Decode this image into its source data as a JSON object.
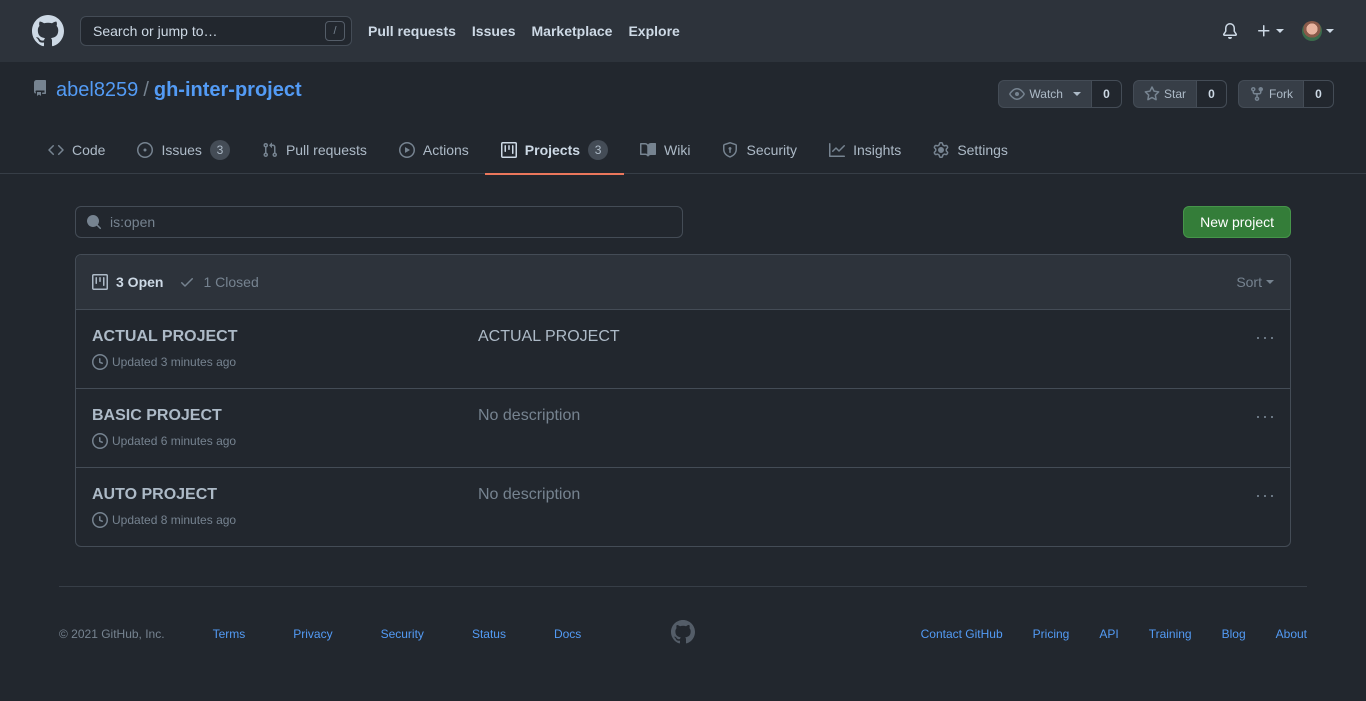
{
  "header": {
    "search_placeholder": "Search or jump to…",
    "search_shortcut": "/",
    "nav": [
      "Pull requests",
      "Issues",
      "Marketplace",
      "Explore"
    ]
  },
  "repo": {
    "owner": "abel8259",
    "separator": "/",
    "name": "gh-inter-project",
    "watch_label": "Watch",
    "watch_count": "0",
    "star_label": "Star",
    "star_count": "0",
    "fork_label": "Fork",
    "fork_count": "0"
  },
  "tabs": [
    {
      "label": "Code",
      "icon": "code-icon"
    },
    {
      "label": "Issues",
      "icon": "issue-icon",
      "count": "3"
    },
    {
      "label": "Pull requests",
      "icon": "pull-request-icon"
    },
    {
      "label": "Actions",
      "icon": "play-icon"
    },
    {
      "label": "Projects",
      "icon": "project-icon",
      "count": "3",
      "selected": true
    },
    {
      "label": "Wiki",
      "icon": "book-icon"
    },
    {
      "label": "Security",
      "icon": "shield-icon"
    },
    {
      "label": "Insights",
      "icon": "graph-icon"
    },
    {
      "label": "Settings",
      "icon": "gear-icon"
    }
  ],
  "projects_page": {
    "filter_value": "is:open",
    "new_project_label": "New project",
    "open_label": "3 Open",
    "closed_label": "1 Closed",
    "sort_label": "Sort",
    "projects": [
      {
        "title": "ACTUAL PROJECT",
        "updated": "Updated 3 minutes ago",
        "description": "ACTUAL PROJECT"
      },
      {
        "title": "BASIC PROJECT",
        "updated": "Updated 6 minutes ago",
        "description": "No description"
      },
      {
        "title": "AUTO PROJECT",
        "updated": "Updated 8 minutes ago",
        "description": "No description"
      }
    ],
    "more_label": "···"
  },
  "footer": {
    "copyright": "© 2021 GitHub, Inc.",
    "left_links": [
      "Terms",
      "Privacy",
      "Security",
      "Status",
      "Docs"
    ],
    "right_links": [
      "Contact GitHub",
      "Pricing",
      "API",
      "Training",
      "Blog",
      "About"
    ]
  },
  "colors": {
    "background": "#22272e",
    "header_bg": "#2d333b",
    "link": "#539bf5",
    "primary_button": "#347d39",
    "tab_underline": "#ec775c"
  }
}
